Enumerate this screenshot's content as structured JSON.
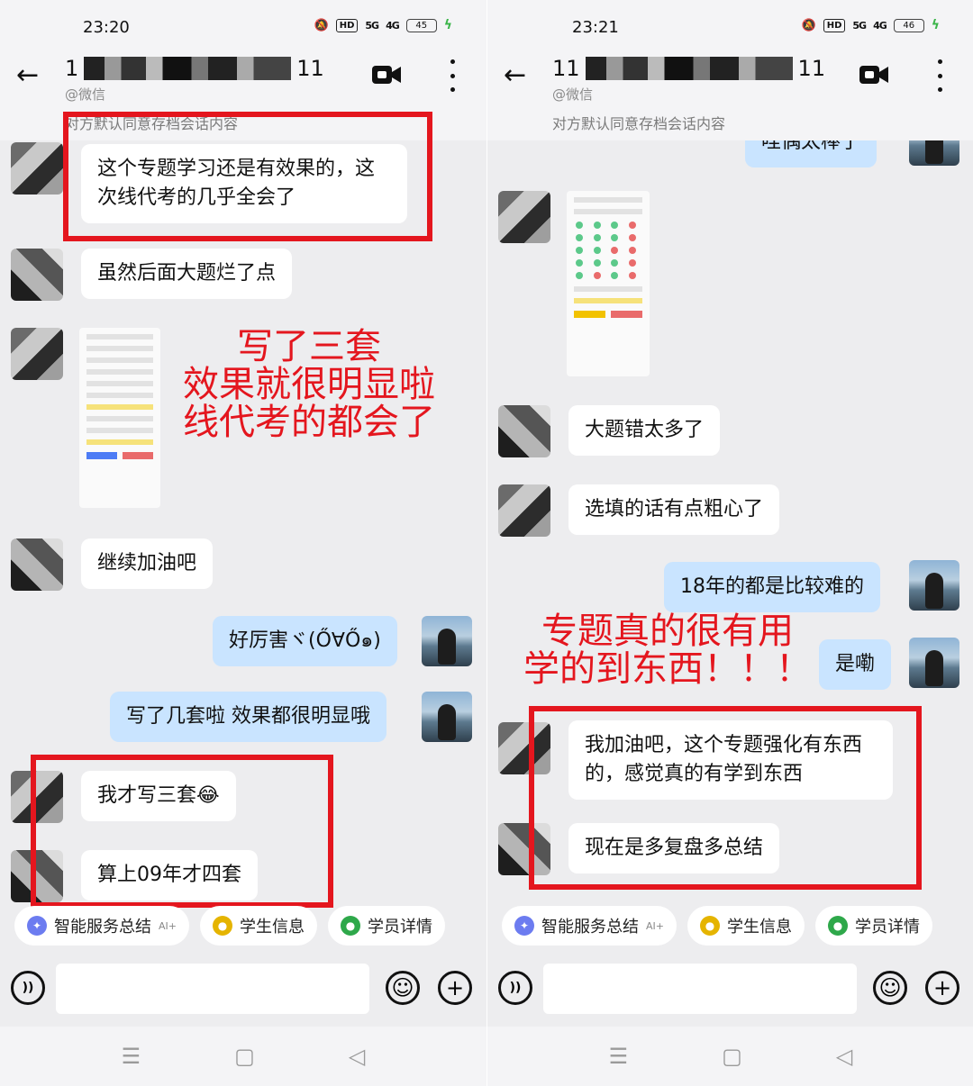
{
  "left": {
    "status": {
      "time": "23:20",
      "hd": "HD",
      "sig1": "5G",
      "sig2": "4G",
      "battery": "45"
    },
    "header": {
      "title_start": "1",
      "title_end": "11",
      "subtitle": "@微信",
      "notice": "对方默认同意存档会话内容"
    },
    "messages": {
      "m1": "这个专题学习还是有效果的，这次线代考的几乎全会了",
      "m2": "虽然后面大题烂了点",
      "m3": "继续加油吧",
      "m4": "好厉害ヾ(ŐꓯŐ๑)",
      "m5": "写了几套啦 效果都很明显哦",
      "m6": "我才写三套😂",
      "m7": "算上09年才四套"
    },
    "overlay": {
      "line1": "写了三套",
      "line2": "效果就很明显啦",
      "line3": "线代考的都会了"
    }
  },
  "right": {
    "status": {
      "time": "23:21",
      "hd": "HD",
      "sig1": "5G",
      "sig2": "4G",
      "battery": "46"
    },
    "header": {
      "title_start": "11",
      "title_end": "11",
      "subtitle": "@微信",
      "notice": "对方默认同意存档会话内容"
    },
    "messages": {
      "m0": "哇偶太棒了",
      "m1": "大题错太多了",
      "m2": "选填的话有点粗心了",
      "m3": "18年的都是比较难的",
      "m4": "是嘞",
      "m5": "我加油吧，这个专题强化有东西的，感觉真的有学到东西",
      "m6": "现在是多复盘多总结"
    },
    "overlay": {
      "line1": "专题真的很有用",
      "line2": "学的到东西！！！"
    }
  },
  "quick": {
    "chip1": "智能服务总结",
    "chip1_ai": "AI+",
    "chip2": "学生信息",
    "chip3": "学员详情"
  },
  "icons": {
    "back": "back-arrow-icon",
    "video": "video-call-icon",
    "more": "more-vertical-icon",
    "voice": "voice-input-icon",
    "emoji": "emoji-icon",
    "plus": "plus-icon",
    "nav_menu": "nav-menu-icon",
    "nav_home": "nav-home-icon",
    "nav_back": "nav-back-icon"
  },
  "colors": {
    "accent_red": "#e4161e",
    "my_bubble": "#c9e4ff",
    "bg": "#ededef"
  }
}
